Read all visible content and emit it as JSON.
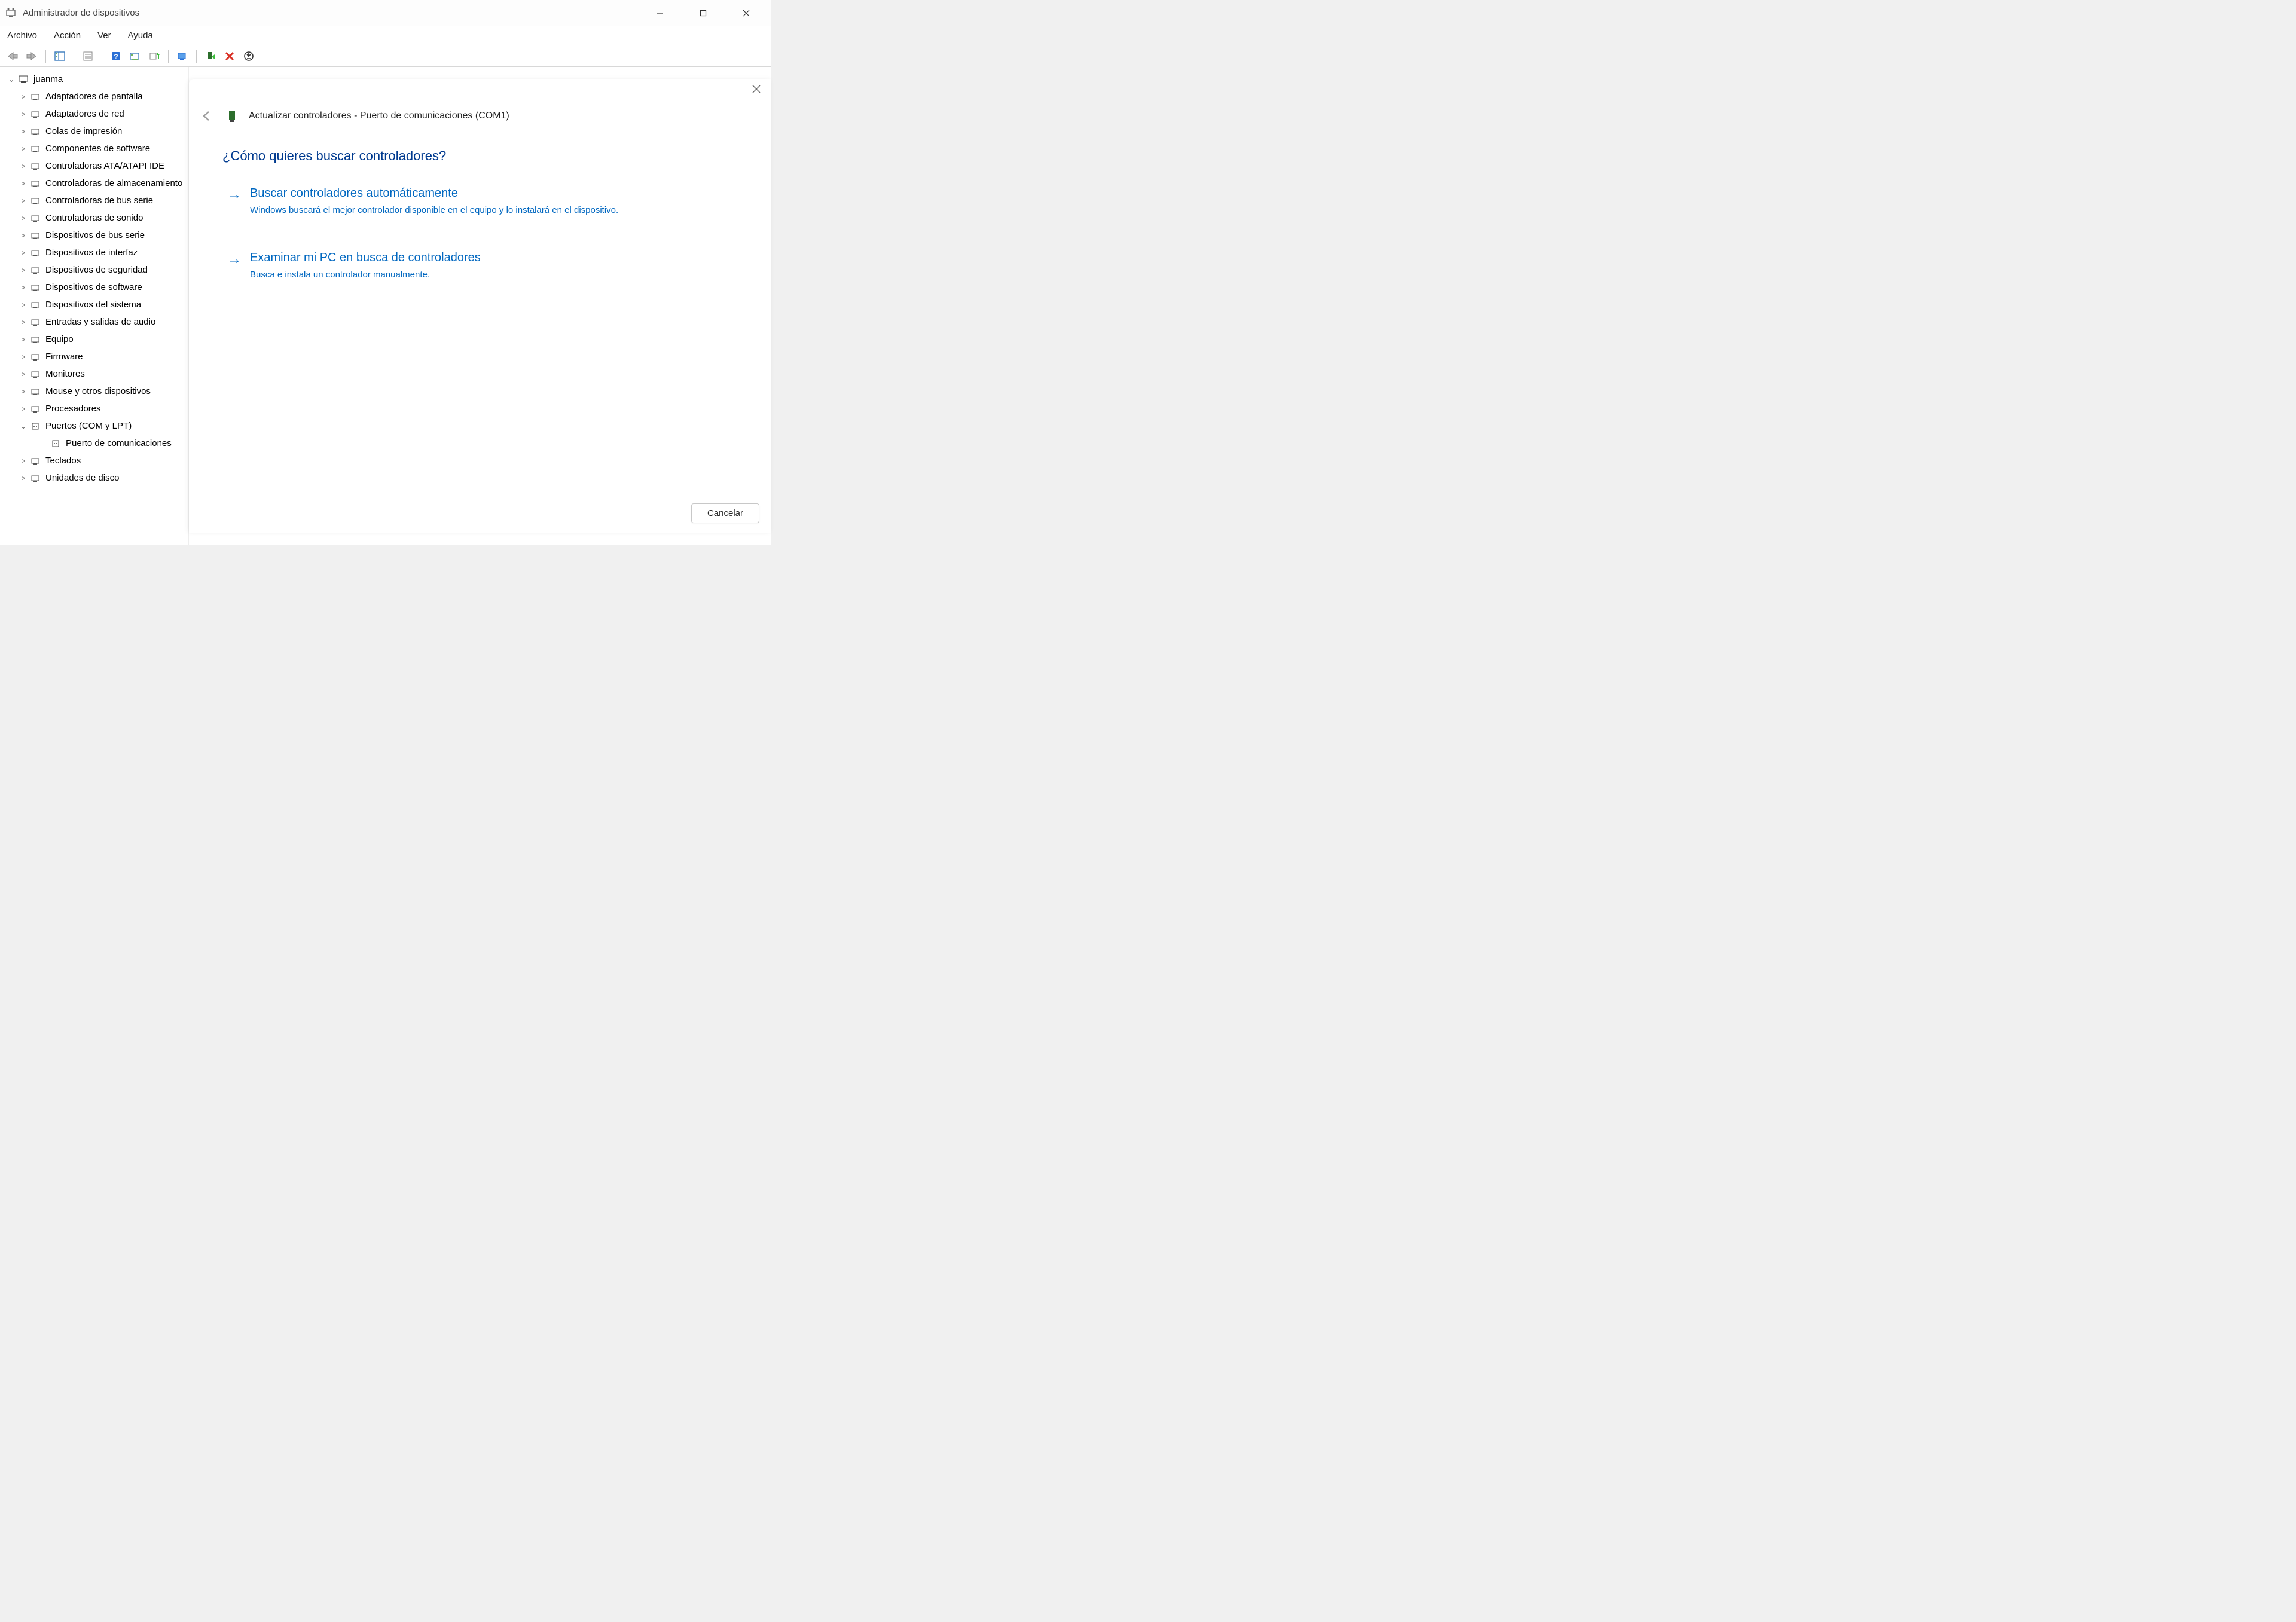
{
  "window": {
    "title": "Administrador de dispositivos"
  },
  "menu": {
    "archivo": "Archivo",
    "accion": "Acción",
    "ver": "Ver",
    "ayuda": "Ayuda"
  },
  "tree": {
    "root": "juanma",
    "items": [
      "Adaptadores de pantalla",
      "Adaptadores de red",
      "Colas de impresión",
      "Componentes de software",
      "Controladoras ATA/ATAPI IDE",
      "Controladoras de almacenamiento",
      "Controladoras de bus serie",
      "Controladoras de sonido",
      "Dispositivos de bus serie",
      "Dispositivos de interfaz",
      "Dispositivos de seguridad",
      "Dispositivos de software",
      "Dispositivos del sistema",
      "Entradas y salidas de audio",
      "Equipo",
      "Firmware",
      "Monitores",
      "Mouse y otros dispositivos",
      "Procesadores"
    ],
    "ports_label": "Puertos (COM y LPT)",
    "port_child": "Puerto de comunicaciones",
    "tail": [
      "Teclados",
      "Unidades de disco"
    ]
  },
  "dialog": {
    "title": "Actualizar controladores - Puerto de comunicaciones (COM1)",
    "question": "¿Cómo quieres buscar controladores?",
    "opt1_title": "Buscar controladores automáticamente",
    "opt1_desc": "Windows buscará el mejor controlador disponible en el equipo y lo instalará en el dispositivo.",
    "opt2_title": "Examinar mi PC en busca de controladores",
    "opt2_desc": "Busca e instala un controlador manualmente.",
    "cancel": "Cancelar"
  }
}
